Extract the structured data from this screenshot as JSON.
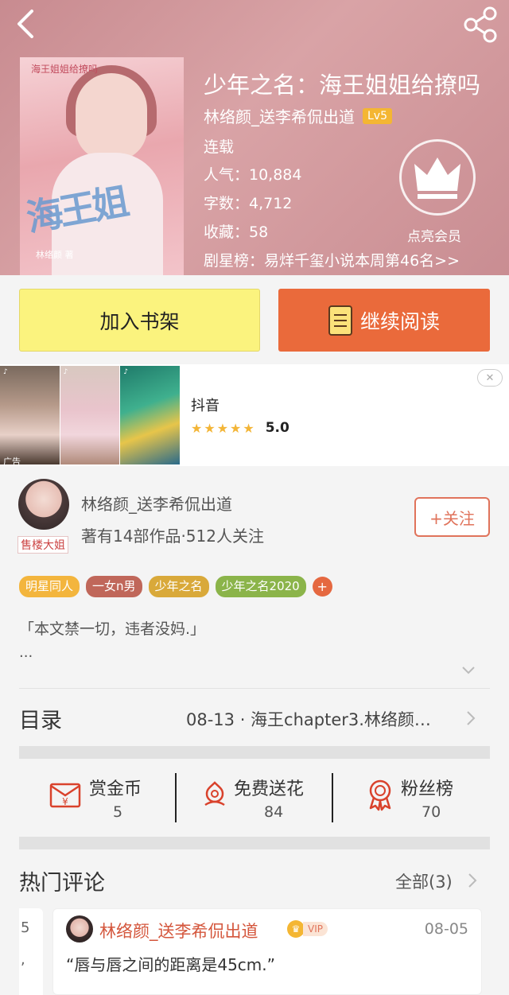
{
  "book": {
    "title": "少年之名：海王姐姐给撩吗",
    "author": "林络颜_送李希侃出道",
    "level": "Lv5",
    "status": "连载",
    "popularity": "人气：10,884",
    "words": "字数：4,712",
    "favorites": "收藏：58",
    "rank": "剧星榜：易烊千玺小说本周第46名>>",
    "vip_label": "点亮会员",
    "cover_title": "海王姐",
    "cover_top": "海王姐姐给撩吗",
    "cover_bottom": "林络颜 著"
  },
  "actions": {
    "add_shelf": "加入书架",
    "continue_read": "继续阅读"
  },
  "ad": {
    "app_name": "抖音",
    "rating": "5.0",
    "tag": "广告",
    "close": "✕",
    "stars": [
      "★",
      "★",
      "★",
      "★",
      "★"
    ]
  },
  "author_info": {
    "name": "林络颜_送李希侃出道",
    "stats": "著有14部作品·512人关注",
    "avatar_tag": "售楼大姐",
    "follow": "+关注"
  },
  "tags": [
    {
      "label": "明星同人",
      "color": "#f3b53d"
    },
    {
      "label": "一女n男",
      "color": "#c0675a"
    },
    {
      "label": "少年之名",
      "color": "#d9a93a"
    },
    {
      "label": "少年之名2020",
      "color": "#8bb44a"
    }
  ],
  "tag_plus": "+",
  "intro": {
    "line1": "「本文禁一切，违者没妈.」",
    "line2": "..."
  },
  "catalog": {
    "label": "目录",
    "latest": "08-13 · 海王chapter3.林络颜…"
  },
  "stats": [
    {
      "name": "赏金币",
      "value": "5",
      "icon": "coin-envelope-icon"
    },
    {
      "name": "免费送花",
      "value": "84",
      "icon": "flower-icon"
    },
    {
      "name": "粉丝榜",
      "value": "70",
      "icon": "medal-icon"
    }
  ],
  "comments": {
    "title": "热门评论",
    "all": "全部(3)",
    "left_partial": [
      "5",
      ","
    ],
    "items": [
      {
        "user": "林络颜_送李希侃出道",
        "vip": "VIP",
        "date": "08-05",
        "text": "“唇与唇之间的距离是45cm.”"
      }
    ]
  },
  "colors": {
    "accent": "#ea6a3b",
    "shelf_button": "#fbf37e",
    "header": "#d09a9e"
  }
}
